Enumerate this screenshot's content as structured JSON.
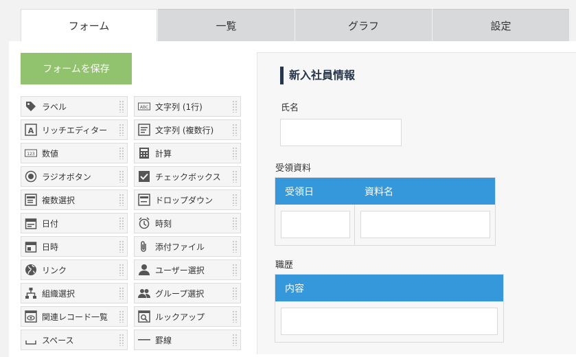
{
  "tabs": [
    {
      "label": "フォーム"
    },
    {
      "label": "一覧"
    },
    {
      "label": "グラフ"
    },
    {
      "label": "設定"
    }
  ],
  "save_button": "フォームを保存",
  "palette": [
    {
      "label": "ラベル",
      "icon": "tag-icon"
    },
    {
      "label": "文字列 (1行)",
      "icon": "abc-icon"
    },
    {
      "label": "リッチエディター",
      "icon": "rich-text-icon"
    },
    {
      "label": "文字列 (複数行)",
      "icon": "multiline-text-icon"
    },
    {
      "label": "数値",
      "icon": "number-icon"
    },
    {
      "label": "計算",
      "icon": "calculator-icon"
    },
    {
      "label": "ラジオボタン",
      "icon": "radio-icon"
    },
    {
      "label": "チェックボックス",
      "icon": "checkbox-icon"
    },
    {
      "label": "複数選択",
      "icon": "multi-select-icon"
    },
    {
      "label": "ドロップダウン",
      "icon": "dropdown-icon"
    },
    {
      "label": "日付",
      "icon": "calendar-icon"
    },
    {
      "label": "時刻",
      "icon": "alarm-clock-icon"
    },
    {
      "label": "日時",
      "icon": "datetime-icon"
    },
    {
      "label": "添付ファイル",
      "icon": "paperclip-icon"
    },
    {
      "label": "リンク",
      "icon": "globe-icon"
    },
    {
      "label": "ユーザー選択",
      "icon": "user-icon"
    },
    {
      "label": "組織選択",
      "icon": "org-icon"
    },
    {
      "label": "グループ選択",
      "icon": "group-icon"
    },
    {
      "label": "関連レコード一覧",
      "icon": "related-records-icon"
    },
    {
      "label": "ルックアップ",
      "icon": "lookup-icon"
    },
    {
      "label": "スペース",
      "icon": "space-icon"
    },
    {
      "label": "罫線",
      "icon": "line-icon"
    }
  ],
  "form": {
    "title": "新入社員情報",
    "name_label": "氏名",
    "received_label": "受領資料",
    "received_cols": [
      "受領日",
      "資料名"
    ],
    "career_label": "職歴",
    "career_cols": [
      "内容"
    ]
  }
}
